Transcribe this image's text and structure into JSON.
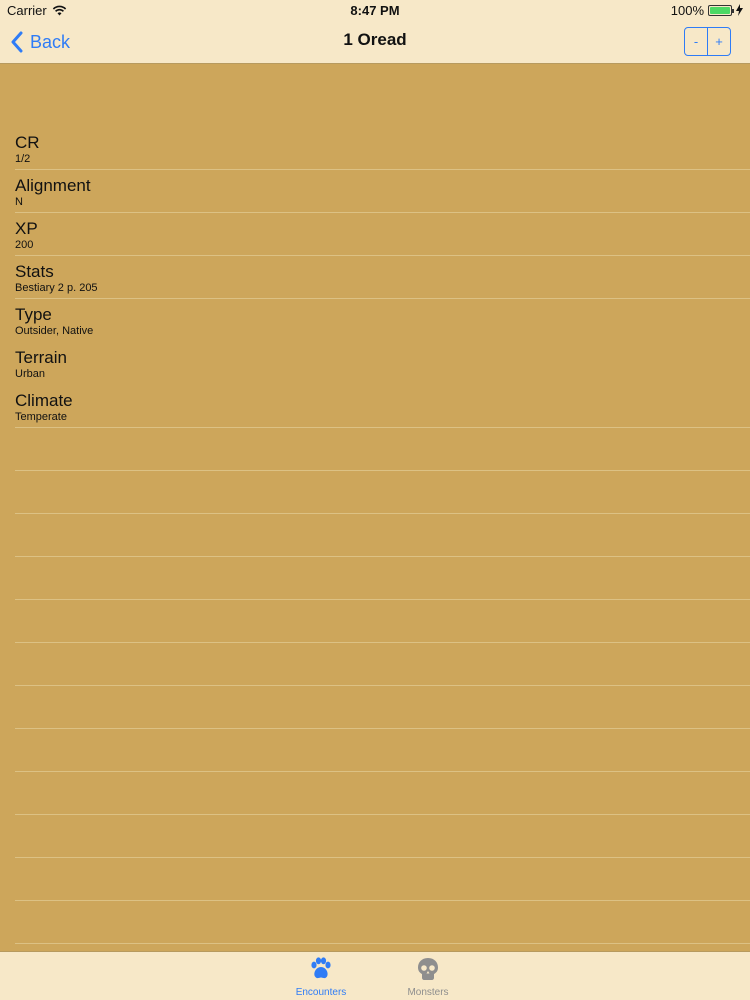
{
  "status_bar": {
    "carrier": "Carrier",
    "time": "8:47 PM",
    "battery": "100%",
    "battery_level": 1.0
  },
  "nav": {
    "back_label": "Back",
    "title": "1 Oread",
    "stepper_minus": "-",
    "stepper_plus": "+"
  },
  "details": [
    {
      "label": "CR",
      "value": "1/2"
    },
    {
      "label": "Alignment",
      "value": "N"
    },
    {
      "label": "XP",
      "value": "200"
    },
    {
      "label": "Stats",
      "value": "Bestiary 2 p. 205"
    },
    {
      "label": "Type",
      "value": "Outsider, Native"
    },
    {
      "label": "Terrain",
      "value": "Urban"
    },
    {
      "label": "Climate",
      "value": "Temperate"
    }
  ],
  "tab_bar": {
    "tabs": [
      {
        "label": "Encounters",
        "icon": "paw-icon",
        "active": true
      },
      {
        "label": "Monsters",
        "icon": "skull-icon",
        "active": false
      }
    ]
  },
  "colors": {
    "background": "#cda65b",
    "bars": "#f7e8c8",
    "accent": "#2f7cf6"
  }
}
